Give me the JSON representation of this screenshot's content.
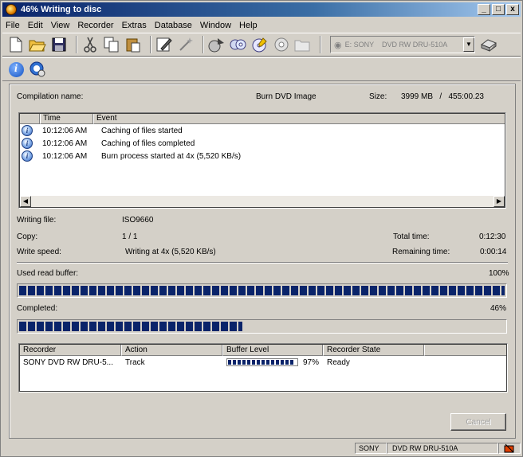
{
  "window": {
    "title": "46% Writing to disc",
    "minimize": "_",
    "maximize": "□",
    "close": "x"
  },
  "menu": [
    "File",
    "Edit",
    "View",
    "Recorder",
    "Extras",
    "Database",
    "Window",
    "Help"
  ],
  "toolbar": {
    "icons": [
      "new-icon",
      "open-icon",
      "save-icon",
      "cut-icon",
      "copy-icon",
      "paste-icon",
      "properties-icon",
      "wizard-icon",
      "burn-icon",
      "disc-copy-icon",
      "disc-info-icon",
      "eject-icon",
      "folder-icon"
    ],
    "recorder_select": "E: SONY    DVD RW DRU-510A"
  },
  "compilation": {
    "name_label": "Compilation name:",
    "name_value": "Burn DVD Image",
    "size_label": "Size:",
    "size_value": "3999 MB   /   455:00.23"
  },
  "log": {
    "columns": [
      "Time",
      "Event"
    ],
    "rows": [
      {
        "time": "10:12:06 AM",
        "event": "Caching of files started"
      },
      {
        "time": "10:12:06 AM",
        "event": "Caching of files completed"
      },
      {
        "time": "10:12:06 AM",
        "event": "Burn process started at 4x (5,520 KB/s)"
      }
    ]
  },
  "status": {
    "writing_file_label": "Writing file:",
    "writing_file_value": "ISO9660",
    "copy_label": "Copy:",
    "copy_value": "1 / 1",
    "write_speed_label": "Write speed:",
    "write_speed_value": "Writing at 4x (5,520 KB/s)",
    "total_time_label": "Total time:",
    "total_time_value": "0:12:30",
    "remaining_label": "Remaining time:",
    "remaining_value": "0:00:14"
  },
  "buffer": {
    "label": "Used read buffer:",
    "percent_text": "100%",
    "fraction": 1.0
  },
  "completed": {
    "label": "Completed:",
    "percent_text": "46%",
    "fraction": 0.46
  },
  "recorders": {
    "columns": [
      "Recorder",
      "Action",
      "Buffer Level",
      "Recorder State"
    ],
    "rows": [
      {
        "recorder": "SONY DVD RW DRU-5...",
        "action": "Track",
        "buffer_text": "97%",
        "buffer_fraction": 0.97,
        "state": "Ready"
      }
    ]
  },
  "cancel_label": "Cancel",
  "statusbar": {
    "vendor": "SONY",
    "model": "DVD RW DRU-510A"
  }
}
